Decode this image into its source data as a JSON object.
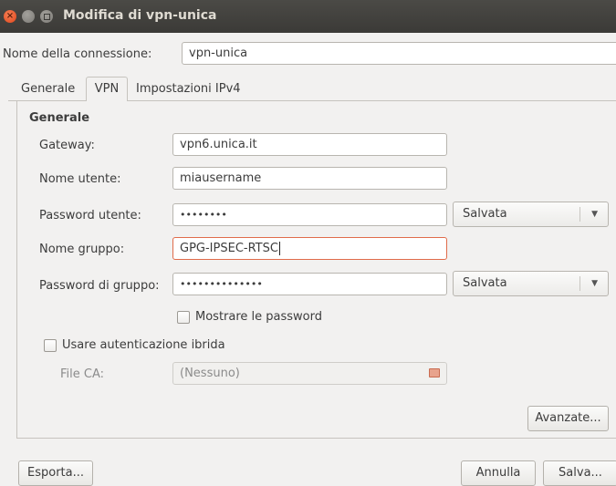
{
  "window": {
    "title": "Modifica di vpn-unica",
    "close_glyph": "×"
  },
  "connection": {
    "name_label": "Nome della connessione:",
    "name_value": "vpn-unica"
  },
  "tabs": [
    {
      "label": "Generale"
    },
    {
      "label": "VPN"
    },
    {
      "label": "Impostazioni IPv4"
    }
  ],
  "section": {
    "title": "Generale"
  },
  "fields": {
    "gateway": {
      "label": "Gateway:",
      "value": "vpn6.unica.it"
    },
    "user": {
      "label": "Nome utente:",
      "value": "miausername"
    },
    "user_password": {
      "label": "Password utente:",
      "value": "••••••••",
      "mode": "Salvata"
    },
    "group": {
      "label": "Nome gruppo:",
      "value": "GPG-IPSEC-RTSC"
    },
    "group_password": {
      "label": "Password di gruppo:",
      "value": "••••••••••••••",
      "mode": "Salvata"
    },
    "ca_file": {
      "label": "File CA:",
      "value": "(Nessuno)"
    }
  },
  "options": {
    "show_passwords": "Mostrare le password",
    "hybrid_auth": "Usare autenticazione ibrida"
  },
  "buttons": {
    "advanced": "Avanzate...",
    "export": "Esporta...",
    "cancel": "Annulla",
    "save": "Salva..."
  },
  "icons": {
    "combo_arrow": "▼",
    "file": "file-icon"
  }
}
